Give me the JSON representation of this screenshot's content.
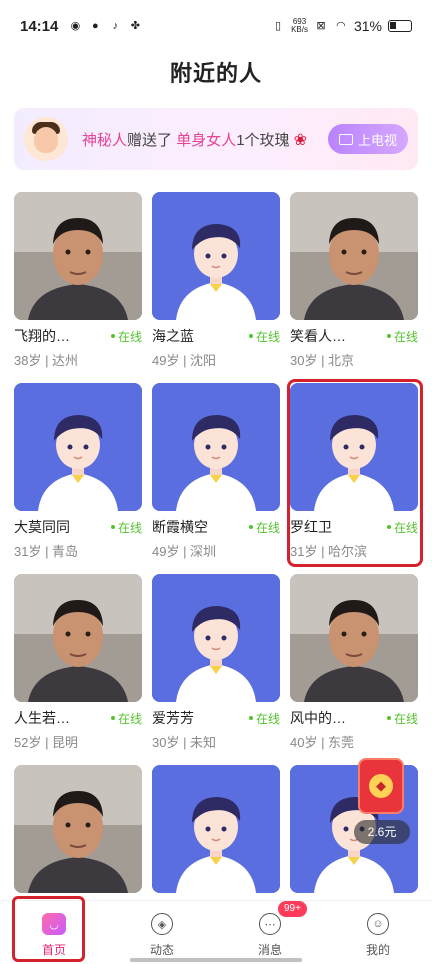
{
  "status_bar": {
    "time": "14:14",
    "net_speed_value": "693",
    "net_speed_unit": "KB/s",
    "battery": "31%"
  },
  "page_title": "附近的人",
  "banner": {
    "part1": "神秘人",
    "part2": "赠送了",
    "part3": "单身女人",
    "part4": "1个玫瑰",
    "tv_button": "上电视"
  },
  "online_label": "在线",
  "people": [
    {
      "name": "飞翔的…",
      "age_city": "38岁 | 达州",
      "photo": "real"
    },
    {
      "name": "海之蓝",
      "age_city": "49岁 | 沈阳",
      "photo": "default"
    },
    {
      "name": "笑看人…",
      "age_city": "30岁 | 北京",
      "photo": "real"
    },
    {
      "name": "大莫同同",
      "age_city": "31岁 | 青岛",
      "photo": "default"
    },
    {
      "name": "断霞横空",
      "age_city": "49岁 | 深圳",
      "photo": "default"
    },
    {
      "name": "罗红卫",
      "age_city": "31岁 | 哈尔滨",
      "photo": "default"
    },
    {
      "name": "人生若…",
      "age_city": "52岁 | 昆明",
      "photo": "real"
    },
    {
      "name": "爱芳芳",
      "age_city": "30岁 | 未知",
      "photo": "default"
    },
    {
      "name": "风中的…",
      "age_city": "40岁 | 东莞",
      "photo": "real"
    },
    {
      "name": "",
      "age_city": "",
      "photo": "real"
    },
    {
      "name": "",
      "age_city": "",
      "photo": "default"
    },
    {
      "name": "",
      "age_city": "",
      "photo": "default"
    }
  ],
  "reward": {
    "amount": "2.6元"
  },
  "nav": {
    "home": "首页",
    "feed": "动态",
    "messages": "消息",
    "messages_badge": "99+",
    "me": "我的"
  }
}
